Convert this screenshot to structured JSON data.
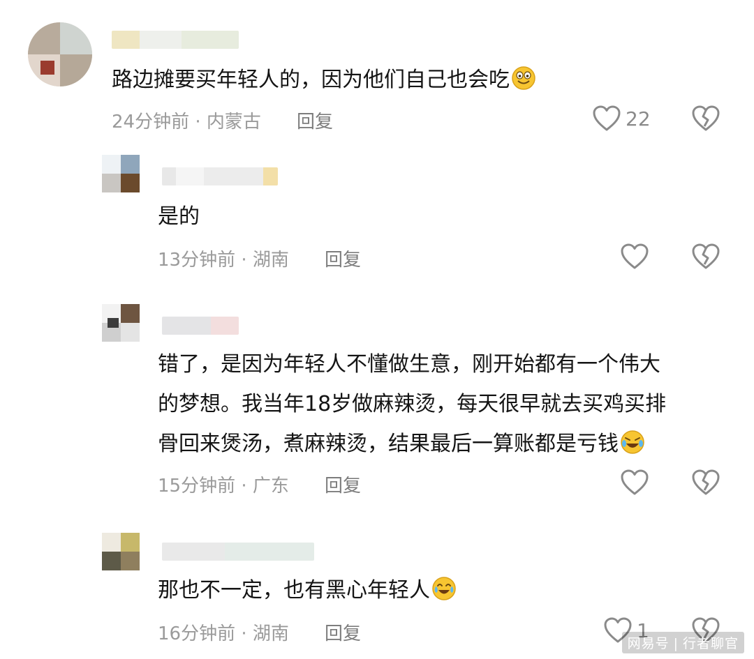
{
  "comments": [
    {
      "text": "路边摊要买年轻人的，因为他们自己也会吃",
      "emoji": "grinning-face",
      "time": "24分钟前",
      "location": "内蒙古",
      "meta_separator": "·",
      "reply_label": "回复",
      "likes": "22"
    },
    {
      "text": "是的",
      "time": "13分钟前",
      "location": "湖南",
      "meta_separator": "·",
      "reply_label": "回复",
      "likes": ""
    },
    {
      "text_line1": "错了，是因为年轻人不懂做生意，刚开始都有一个伟大",
      "text_line2": "的梦想。我当年18岁做麻辣烫，每天很早就去买鸡买排",
      "text_line3": "骨回来煲汤，煮麻辣烫，结果最后一算账都是亏钱",
      "emoji": "rolling-laughing-face",
      "time": "15分钟前",
      "location": "广东",
      "meta_separator": "·",
      "reply_label": "回复",
      "likes": ""
    },
    {
      "text": "那也不一定，也有黑心年轻人",
      "emoji": "crying-laughing-face",
      "time": "16分钟前",
      "location": "湖南",
      "meta_separator": "·",
      "reply_label": "回复",
      "likes": "1"
    }
  ],
  "icons": {
    "like": "heart-outline-icon",
    "dislike": "broken-heart-icon"
  },
  "watermark": {
    "brand": "网易号",
    "separator": "|",
    "author": "行者聊官"
  },
  "colors": {
    "text": "#141414",
    "meta": "#9a9a9a",
    "reply": "#7d7d7d",
    "icon": "#8a8a8a",
    "emoji": "#f7c531"
  }
}
